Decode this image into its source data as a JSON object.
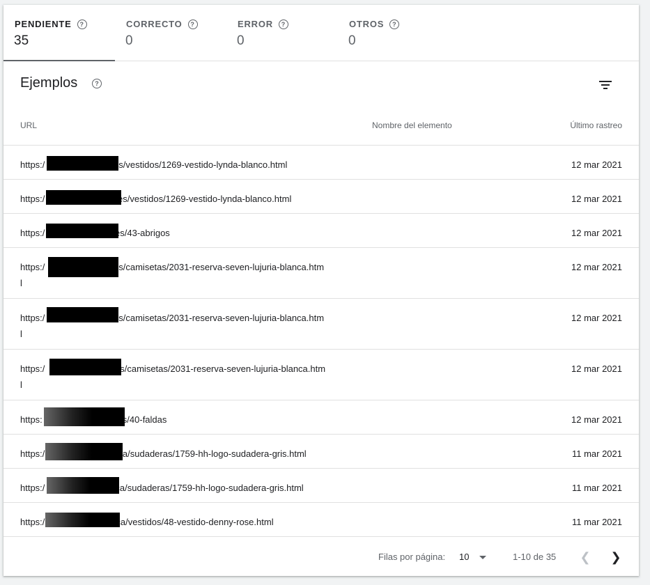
{
  "tabs": [
    {
      "label": "PENDIENTE",
      "value": "35",
      "active": true
    },
    {
      "label": "CORRECTO",
      "value": "0",
      "active": false
    },
    {
      "label": "ERROR",
      "value": "0",
      "active": false
    },
    {
      "label": "OTROS",
      "value": "0",
      "active": false
    }
  ],
  "help_glyph": "?",
  "section": {
    "title": "Ejemplos"
  },
  "columns": {
    "url": "URL",
    "name": "Nombre del elemento",
    "crawl": "Último rastreo"
  },
  "rows": [
    {
      "url_prefix": "https:/",
      "url_suffix": "/es/vestidos/1269-vestido-lynda-blanco.html",
      "date": "12 mar 2021"
    },
    {
      "url_prefix": "https:/",
      "url_suffix": "/es/vestidos/1269-vestido-lynda-blanco.html",
      "date": "12 mar 2021"
    },
    {
      "url_prefix": "https:/",
      "url_suffix": "/es/43-abrigos",
      "date": "12 mar 2021"
    },
    {
      "url_prefix": "https:/",
      "url_suffix": "/es/camisetas/2031-reserva-seven-lujuria-blanca.htm",
      "url_cont": "l",
      "date": "12 mar 2021"
    },
    {
      "url_prefix": "https:/",
      "url_suffix": "/es/camisetas/2031-reserva-seven-lujuria-blanca.htm",
      "url_cont": "l",
      "date": "12 mar 2021"
    },
    {
      "url_prefix": "https:/",
      "url_suffix": "/es/camisetas/2031-reserva-seven-lujuria-blanca.htm",
      "url_cont": "l",
      "date": "12 mar 2021"
    },
    {
      "url_prefix": "https:",
      "url_suffix": "s/40-faldas",
      "date": "12 mar 2021"
    },
    {
      "url_prefix": "https:/",
      "url_suffix": "ca/sudaderas/1759-hh-logo-sudadera-gris.html",
      "date": "11 mar 2021"
    },
    {
      "url_prefix": "https:/",
      "url_suffix": "ca/sudaderas/1759-hh-logo-sudadera-gris.html",
      "date": "11 mar 2021"
    },
    {
      "url_prefix": "https:/",
      "url_suffix": "ca/vestidos/48-vestido-denny-rose.html",
      "date": "11 mar 2021"
    }
  ],
  "footer": {
    "rows_per_page_label": "Filas por página:",
    "rows_per_page_value": "10",
    "range": "1-10 de 35",
    "prev_icon": "chevron-left-icon",
    "next_icon": "chevron-right-icon"
  }
}
